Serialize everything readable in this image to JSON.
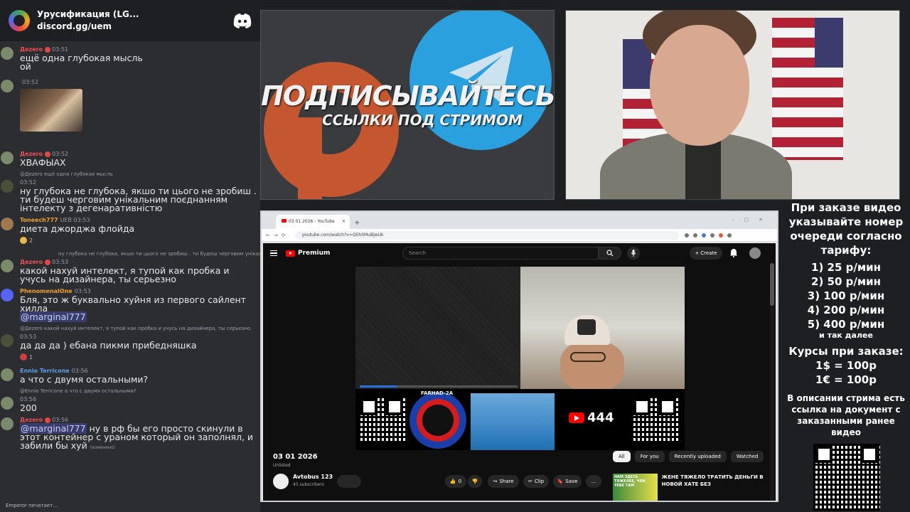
{
  "discord": {
    "server_name": "Урусификация (LG...",
    "server_link": "discord.gg/uem",
    "messages": [
      {
        "user": "Дezero",
        "time": "03:51",
        "text": "ещё одна глубокая мысль"
      },
      {
        "text": "ой"
      },
      {
        "user": "",
        "time": "03:52"
      },
      {
        "user": "Дezero",
        "time": "03:52",
        "text": "ХВАФЫАХ"
      },
      {
        "reply": "@Дezero ещё одна глубокая мысль",
        "time": "03:52",
        "text": "ну глубока не глубока, якшо ти цього не зробиш . ти будеш черговим унікальним  поєднанням інтелекту з дегенаративністю"
      },
      {
        "user": "Toneech777",
        "tags": "UEB",
        "time": "03:53",
        "text": "диета джорджа флойда",
        "reaction_count": "2"
      },
      {
        "reply": "ну глубока не глубока, якшо ти цього не зробиш . ти  будеш черговим унікальним  поєднанням інтелекту з дег",
        "user": "Дezero",
        "time": "03:53",
        "text": "какой нахуй интелект, я тупой как пробка и учусь на дизайнера, ты серьезно"
      },
      {
        "user": "PhenomenalOne",
        "time": "03:53",
        "text": "Бля, это ж буквально хуйня из первого сайлент хилла",
        "mention": "@marginal777"
      },
      {
        "reply": "@Дezero какой нахуй интелект, я тупой как пробка и учусь на дизайнера, ты серьезно",
        "time": "03:53",
        "text": "да да да )  ебана пикми прибедняшка",
        "reaction_count": "1"
      },
      {
        "user": "Ennio Terricone",
        "time": "03:56",
        "text": "а что с двумя остальными?"
      },
      {
        "reply": "@Ennio Terricone  а что с двумя остальными?",
        "time": "03:56",
        "text": "200"
      },
      {
        "user": "Дezero",
        "time": "03:56",
        "mention": "@marginal777",
        "text": "ну в рф бы его просто скинули в этот контейнер с ураном который он заполнял, и забили бы хуй",
        "edited": "(изменено)"
      }
    ],
    "footer": "Emperor печатает..."
  },
  "promo": {
    "title": "ПОДПИСЫВАЙТЕСЬ",
    "subtitle": "ССЫЛКИ ПОД СТРИМОМ"
  },
  "browser": {
    "tab_title": "03 01 2026 - YouTube",
    "url": "youtube.com/watch?v=Q5hSMuBjwUk",
    "youtube": {
      "logo_text": "Premium",
      "search_placeholder": "Search",
      "create_label": "Create",
      "video_title": "03 01 2026",
      "visibility": "Unlisted",
      "channel_name": "Avtobus 123",
      "channel_subs": "45 subscribers",
      "likes": "0",
      "share_label": "Share",
      "clip_label": "Clip",
      "save_label": "Save",
      "more_label": "...",
      "overlay_subscribers": "444",
      "overlay_badge_text": "FARHAD-2A",
      "chips": [
        "All",
        "For you",
        "Recently uploaded",
        "Watched"
      ],
      "reco_title": "ЖЕНЕ ТЯЖЕЛО ТРАТИТЬ ДЕНЬГИ В НОВОЙ ХАТЕ БЕЗ",
      "reco_thumb_text": "НАМ ЗДЕСЬ ТЯЖЕЛЕЕ, ЧЕМ ТЕБЕ ТАМ"
    }
  },
  "info": {
    "heading": "При заказе видео указывайте номер очереди согласно тарифу:",
    "tariffs": [
      "1) 25 р/мин",
      "2) 50 р/мин",
      "3) 100 р/мин",
      "4) 200 р/мин",
      "5) 400 р/мин"
    ],
    "etc": "и так далее",
    "rates_heading": "Курсы при заказе:",
    "rates": [
      "1$ = 100р",
      "1€ = 100р"
    ],
    "description": "В описании стрима есть ссылка на документ с заказанными ранее видео"
  }
}
